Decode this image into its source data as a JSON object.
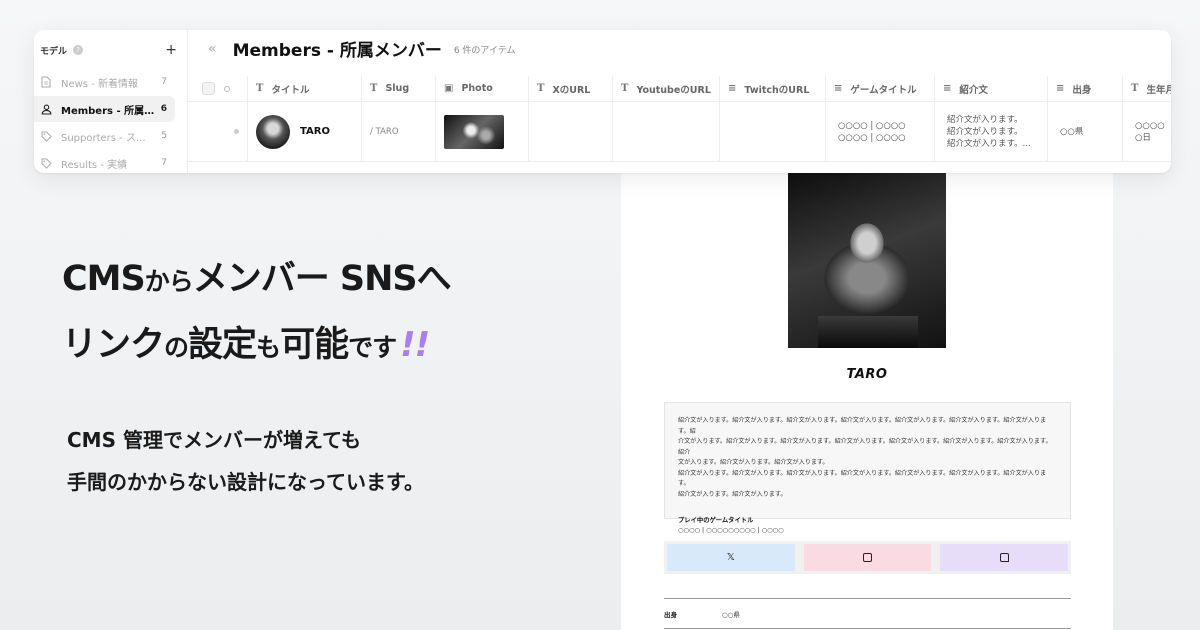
{
  "sidebar": {
    "header": "モデル",
    "help_icon": "question-circle-icon",
    "add_icon": "plus-icon",
    "items": [
      {
        "icon": "document-icon",
        "label": "News - 新着情報",
        "count": "7"
      },
      {
        "icon": "person-icon",
        "label": "Members - 所属...",
        "count": "6"
      },
      {
        "icon": "tag-icon",
        "label": "Supporters - ス...",
        "count": "5"
      },
      {
        "icon": "tag-icon",
        "label": "Results - 実績",
        "count": "7"
      }
    ]
  },
  "main": {
    "collapse_icon": "chevrons-left-icon",
    "title": "Members - 所属メンバー",
    "count": "6 件のアイテム",
    "columns": [
      {
        "icon": "text-icon",
        "label": "タイトル"
      },
      {
        "icon": "text-icon",
        "label": "Slug"
      },
      {
        "icon": "image-icon",
        "label": "Photo"
      },
      {
        "icon": "text-icon",
        "label": "XのURL"
      },
      {
        "icon": "text-icon",
        "label": "YoutubeのURL"
      },
      {
        "icon": "lines-icon",
        "label": "TwitchのURL"
      },
      {
        "icon": "lines-icon",
        "label": "ゲームタイトル"
      },
      {
        "icon": "lines-icon",
        "label": "紹介文"
      },
      {
        "icon": "lines-icon",
        "label": "出身"
      },
      {
        "icon": "text-icon",
        "label": "生年月"
      }
    ],
    "row": {
      "title": "TARO",
      "slug": "/ TARO",
      "x_url": "",
      "youtube_url": "",
      "twitch_url": "",
      "game_title": [
        "○○○○ | ○○○○",
        "○○○○ | ○○○○"
      ],
      "intro": [
        "紹介文が入ります。",
        "紹介文が入ります。",
        "紹介文が入ります。..."
      ],
      "origin": "○○県",
      "birth": [
        "○○○○",
        "○日"
      ]
    }
  },
  "copy": {
    "headline_1a": "CMS",
    "headline_1b": "から",
    "headline_1c": "メンバー SNS",
    "headline_1d": "へ",
    "headline_2a": "リンク",
    "headline_2b": "の",
    "headline_2c": "設定",
    "headline_2d": "も",
    "headline_2e": "可能",
    "headline_2f": "です",
    "headline_2g": "!!",
    "sub_1": "CMS 管理でメンバーが増えても",
    "sub_2": "手間のかからない設計になっています。"
  },
  "preview": {
    "name": "TARO",
    "intro_lines": [
      "紹介文が入ります。紹介文が入ります。紹介文が入ります。紹介文が入ります。紹介文が入ります。紹介文が入ります。紹介文が入ります。紹",
      "介文が入ります。紹介文が入ります。紹介文が入ります。紹介文が入ります。紹介文が入ります。紹介文が入ります。紹介文が入ります。紹介",
      "文が入ります。紹介文が入ります。紹介文が入ります。",
      "紹介文が入ります。紹介文が入ります。紹介文が入ります。紹介文が入ります。紹介文が入ります。紹介文が入ります。紹介文が入ります。",
      "紹介文が入ります。紹介文が入ります。"
    ],
    "game_label": "プレイ中のゲームタイトル",
    "game_value": "○○○○ | ○○○○○○○○○ | ○○○○",
    "sns": [
      {
        "icon": "x-icon",
        "glyph": "𝕏",
        "color": "#d8e9fb"
      },
      {
        "icon": "youtube-icon",
        "color": "#fbdbe3"
      },
      {
        "icon": "twitch-icon",
        "color": "#e7dcfa"
      }
    ],
    "origin_label": "出身",
    "origin_value": "○○県"
  },
  "colors": {
    "accent_exclamation": "#a97ff0"
  }
}
